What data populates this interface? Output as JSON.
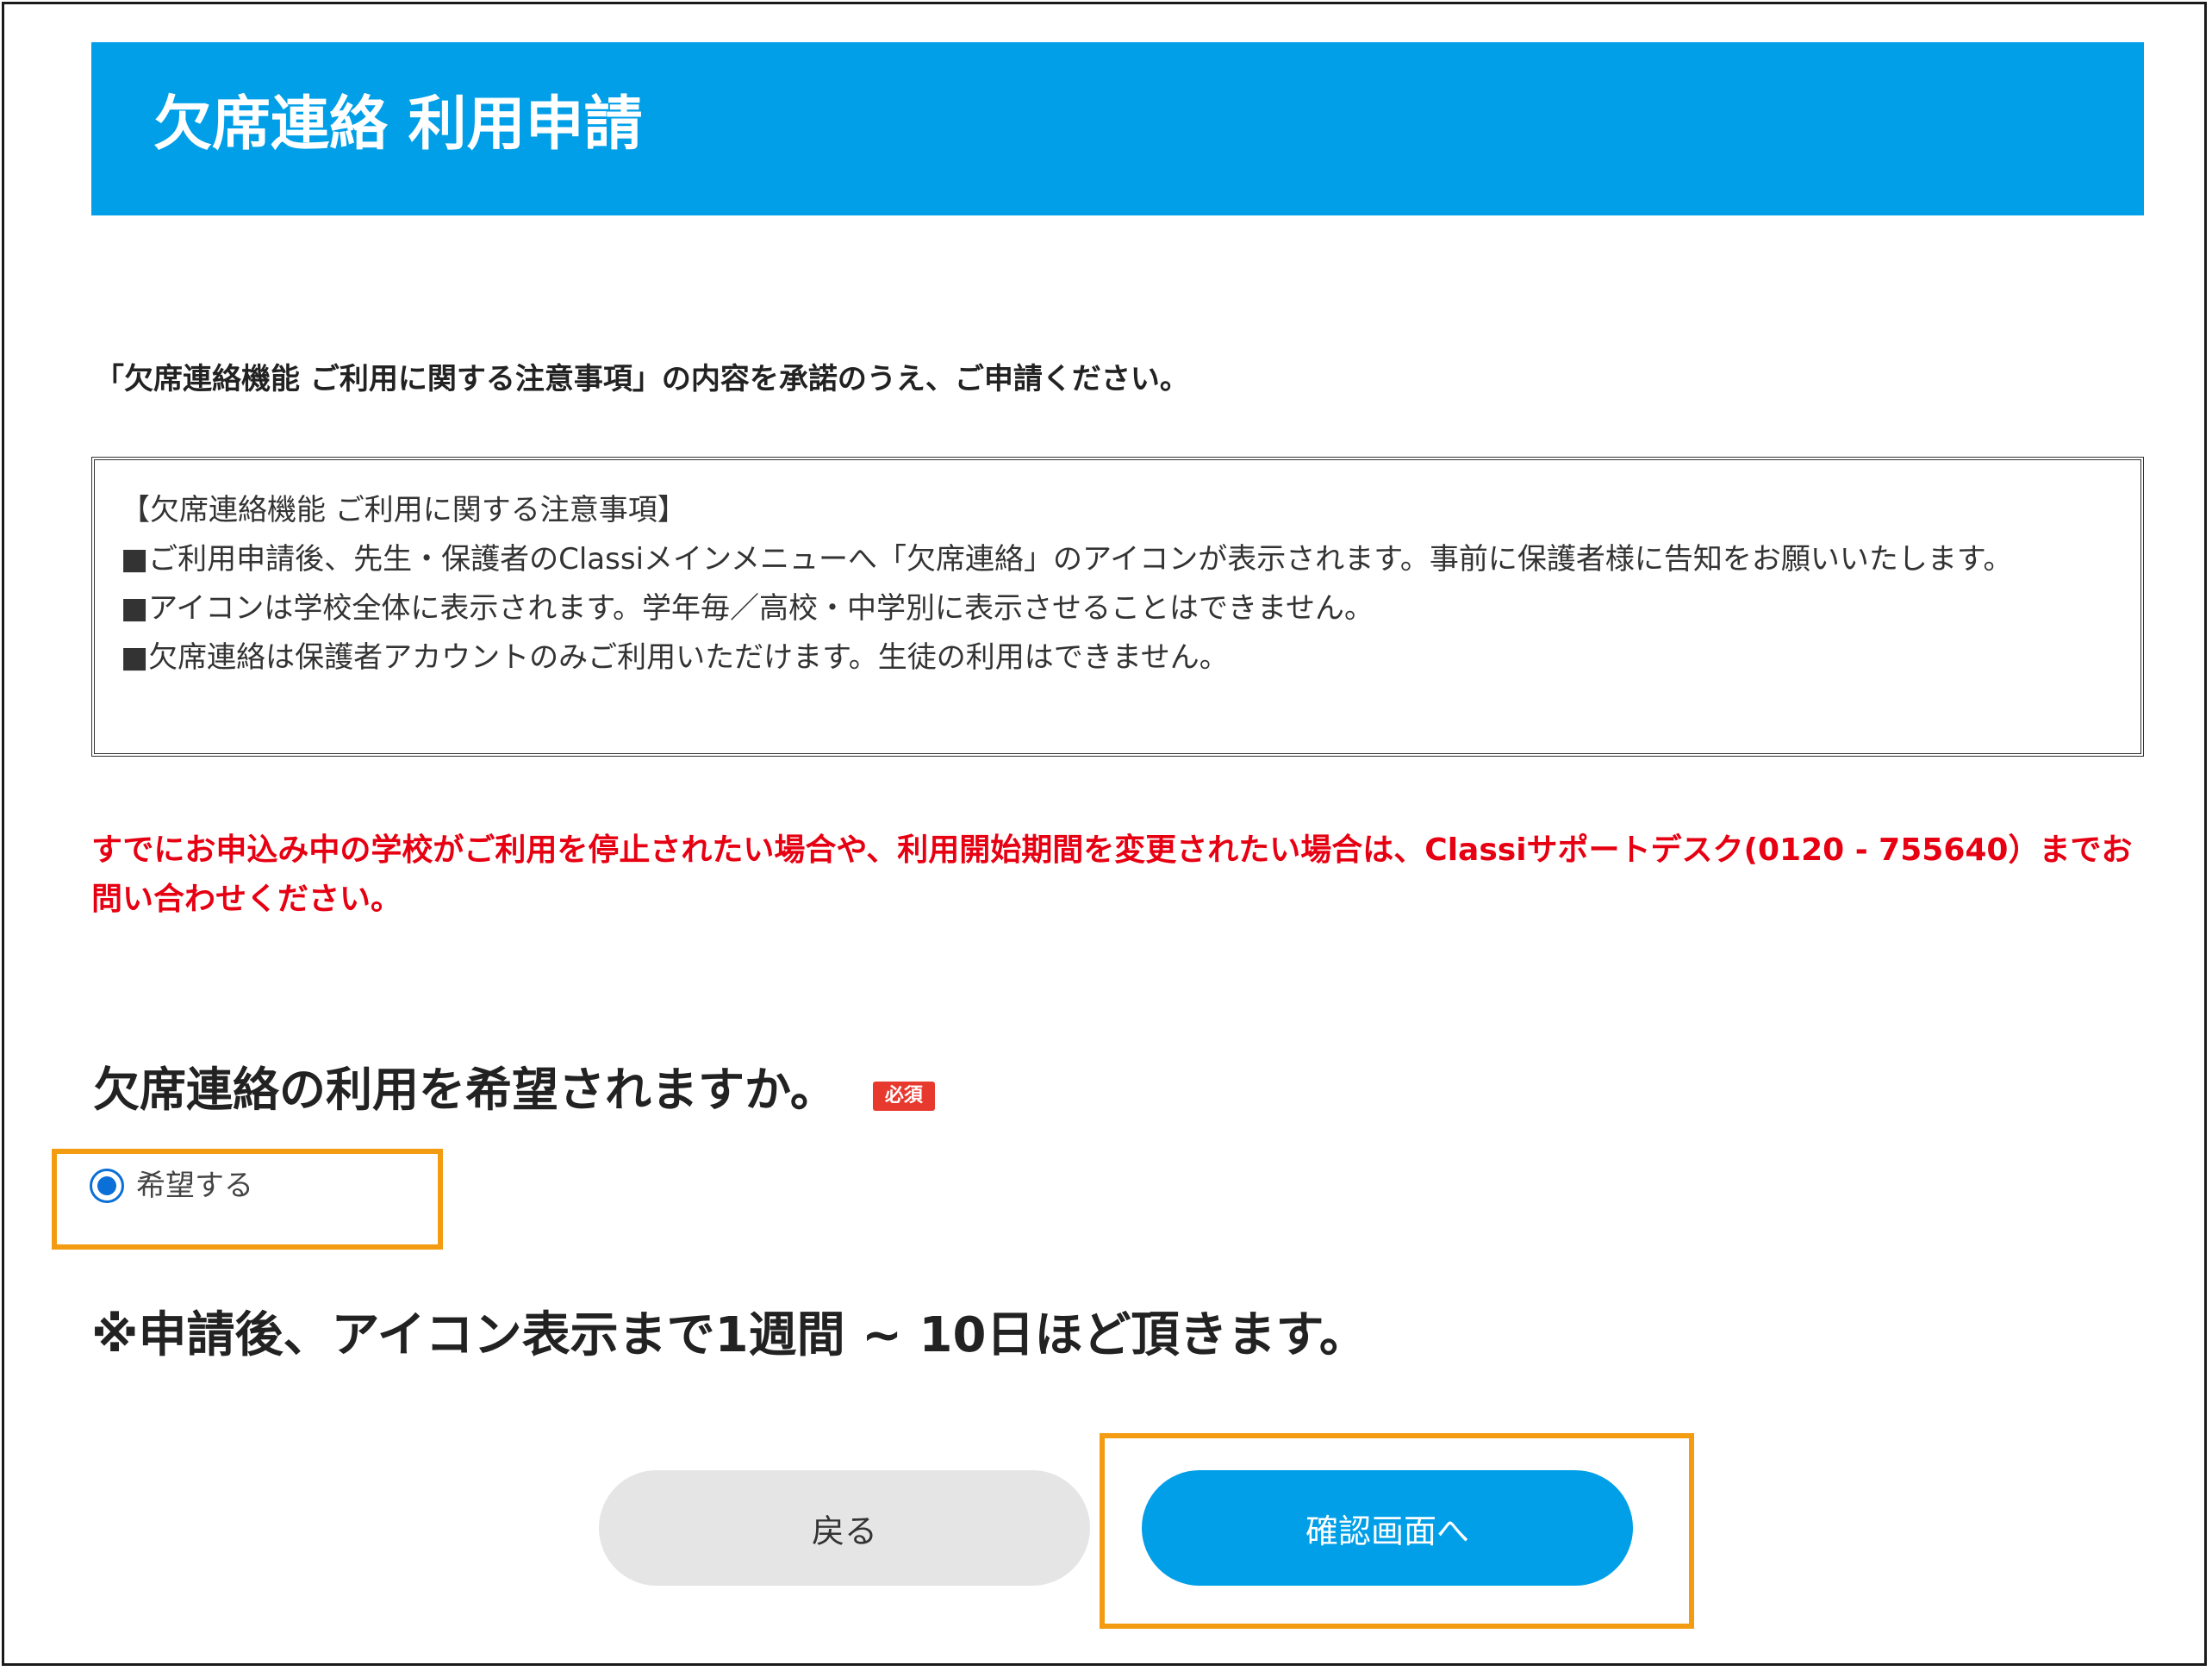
{
  "header": {
    "title": "欠席連絡 利用申請"
  },
  "intro": "「欠席連絡機能 ご利用に関する注意事項」の内容を承諾のうえ、ご申請ください。",
  "notice": {
    "heading": "【欠席連絡機能 ご利用に関する注意事項】",
    "lines": [
      "■ご利用申請後、先生・保護者のClassiメインメニューへ「欠席連絡」のアイコンが表示されます。事前に保護者様に告知をお願いいたします。",
      "■アイコンは学校全体に表示されます。学年毎／高校・中学別に表示させることはできません。",
      "■欠席連絡は保護者アカウントのみご利用いただけます。生徒の利用はできません。"
    ]
  },
  "red_note": "すでにお申込み中の学校がご利用を停止されたい場合や、利用開始期間を変更されたい場合は、Classiサポートデスク(0120 - 755640）までお問い合わせください。",
  "question": {
    "label": "欠席連絡の利用を希望されますか。",
    "required_badge": "必須",
    "options": [
      {
        "label": "希望する",
        "selected": true
      }
    ]
  },
  "note_after": "※申請後、アイコン表示まで1週間 ~ 10日ほど頂きます。",
  "buttons": {
    "back_label": "戻る",
    "confirm_label": "確認画面へ"
  },
  "colors": {
    "header_bg": "#009fe8",
    "primary_button": "#009fe8",
    "secondary_button": "#e5e5e5",
    "alert_text": "#e60012",
    "required_badge": "#e8392e",
    "highlight_outline": "#f39c12"
  }
}
